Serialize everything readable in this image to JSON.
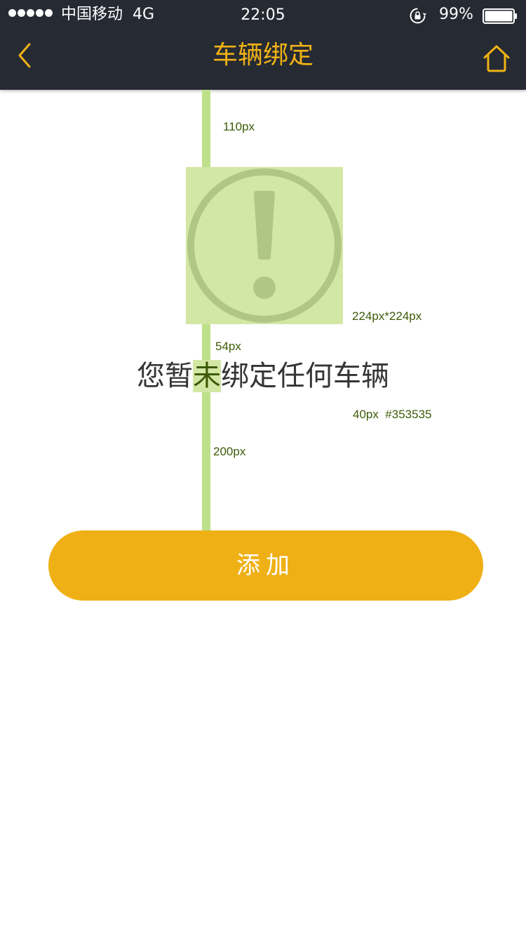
{
  "status_bar": {
    "carrier": "中国移动",
    "network": "4G",
    "time": "22:05",
    "battery": "99%",
    "battery_level": 0.99,
    "signal_dots": 5
  },
  "nav": {
    "title": "车辆绑定",
    "back_icon": "chevron-left-icon",
    "home_icon": "home-icon"
  },
  "empty_state": {
    "icon": "warning-exclamation-icon",
    "message_before": "您暂",
    "message_highlight": "未",
    "message_after": "绑定任何车辆",
    "button_label": "添加"
  },
  "annotations": {
    "top_gap": "110px",
    "icon_size": "224px*224px",
    "icon_text_gap": "54px",
    "font_spec": "40px  #353535",
    "text_button_gap": "200px"
  },
  "colors": {
    "nav_bg": "#262a33",
    "accent": "#f0b215",
    "button": "#efb016",
    "text": "#353535",
    "guide": "#bee08a",
    "guide_text": "#3d5b07"
  }
}
